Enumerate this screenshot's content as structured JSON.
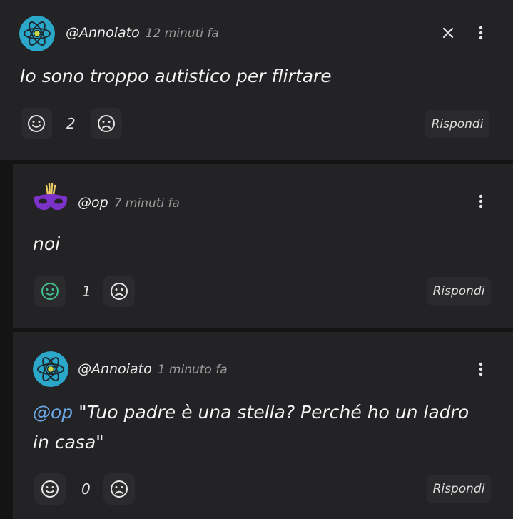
{
  "comments": [
    {
      "username": "@Annoiato",
      "time": "12 minuti fa",
      "text": "Io sono troppo autistico per flirtare",
      "likes": "2",
      "reply_label": "Rispondi",
      "liked": false
    },
    {
      "username": "@op",
      "time": "7 minuti fa",
      "text": "noi",
      "likes": "1",
      "reply_label": "Rispondi",
      "liked": true
    },
    {
      "username": "@Annoiato",
      "time": "1 minuto fa",
      "mention": "@op",
      "text_line1": " \"Tuo padre è una stella? Perché ho un ladro",
      "text_line2": "in casa\"",
      "likes": "0",
      "reply_label": "Rispondi",
      "liked": false
    }
  ],
  "colors": {
    "accent_like": "#3fbf8a",
    "mention": "#6aa8e6",
    "mask_purple": "#7b32c9"
  }
}
